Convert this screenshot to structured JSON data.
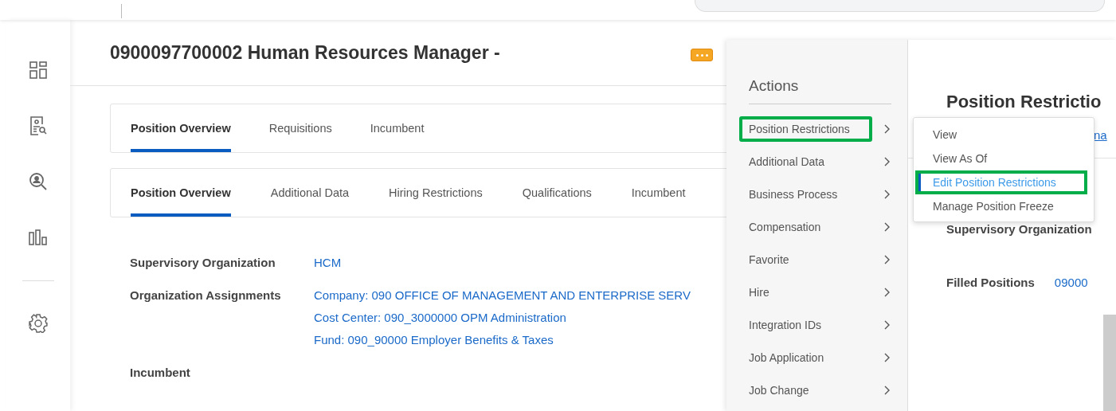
{
  "header": {
    "title": "0900097700002 Human Resources Manager -"
  },
  "primary_tabs": [
    {
      "label": "Position Overview",
      "selected": true
    },
    {
      "label": "Requisitions",
      "selected": false
    },
    {
      "label": "Incumbent",
      "selected": false
    }
  ],
  "secondary_tabs": [
    {
      "label": "Position Overview",
      "selected": true
    },
    {
      "label": "Additional Data",
      "selected": false
    },
    {
      "label": "Hiring Restrictions",
      "selected": false
    },
    {
      "label": "Qualifications",
      "selected": false
    },
    {
      "label": "Incumbent",
      "selected": false
    }
  ],
  "fields": [
    {
      "label": "Supervisory Organization",
      "values": [
        "HCM"
      ]
    },
    {
      "label": "Organization Assignments",
      "values": [
        "Company: 090 OFFICE OF MANAGEMENT AND ENTERPRISE SERV",
        "Cost Center: 090_3000000 OPM Administration",
        "Fund: 090_90000 Employer Benefits & Taxes"
      ]
    },
    {
      "label": "Incumbent"
    }
  ],
  "actions_menu": {
    "title": "Actions",
    "items": [
      {
        "label": "Position Restrictions",
        "highlighted": true
      },
      {
        "label": "Additional Data",
        "highlighted": false
      },
      {
        "label": "Business Process",
        "highlighted": false
      },
      {
        "label": "Compensation",
        "highlighted": false
      },
      {
        "label": "Favorite",
        "highlighted": false
      },
      {
        "label": "Hire",
        "highlighted": false
      },
      {
        "label": "Integration IDs",
        "highlighted": false
      },
      {
        "label": "Job Application",
        "highlighted": false
      },
      {
        "label": "Job Change",
        "highlighted": false
      }
    ]
  },
  "submenu": {
    "items": [
      {
        "label": "View",
        "selected": false,
        "highlighted": false
      },
      {
        "label": "View As Of",
        "selected": false,
        "highlighted": false
      },
      {
        "label": "Edit Position Restrictions",
        "selected": true,
        "highlighted": true
      },
      {
        "label": "Manage Position Freeze",
        "selected": false,
        "highlighted": false
      }
    ]
  },
  "preview": {
    "title": "Position Restrictio",
    "link": "na",
    "fields": [
      {
        "label": "Supervisory Organization"
      },
      {
        "label": "Filled Positions",
        "value": "09000"
      }
    ]
  }
}
